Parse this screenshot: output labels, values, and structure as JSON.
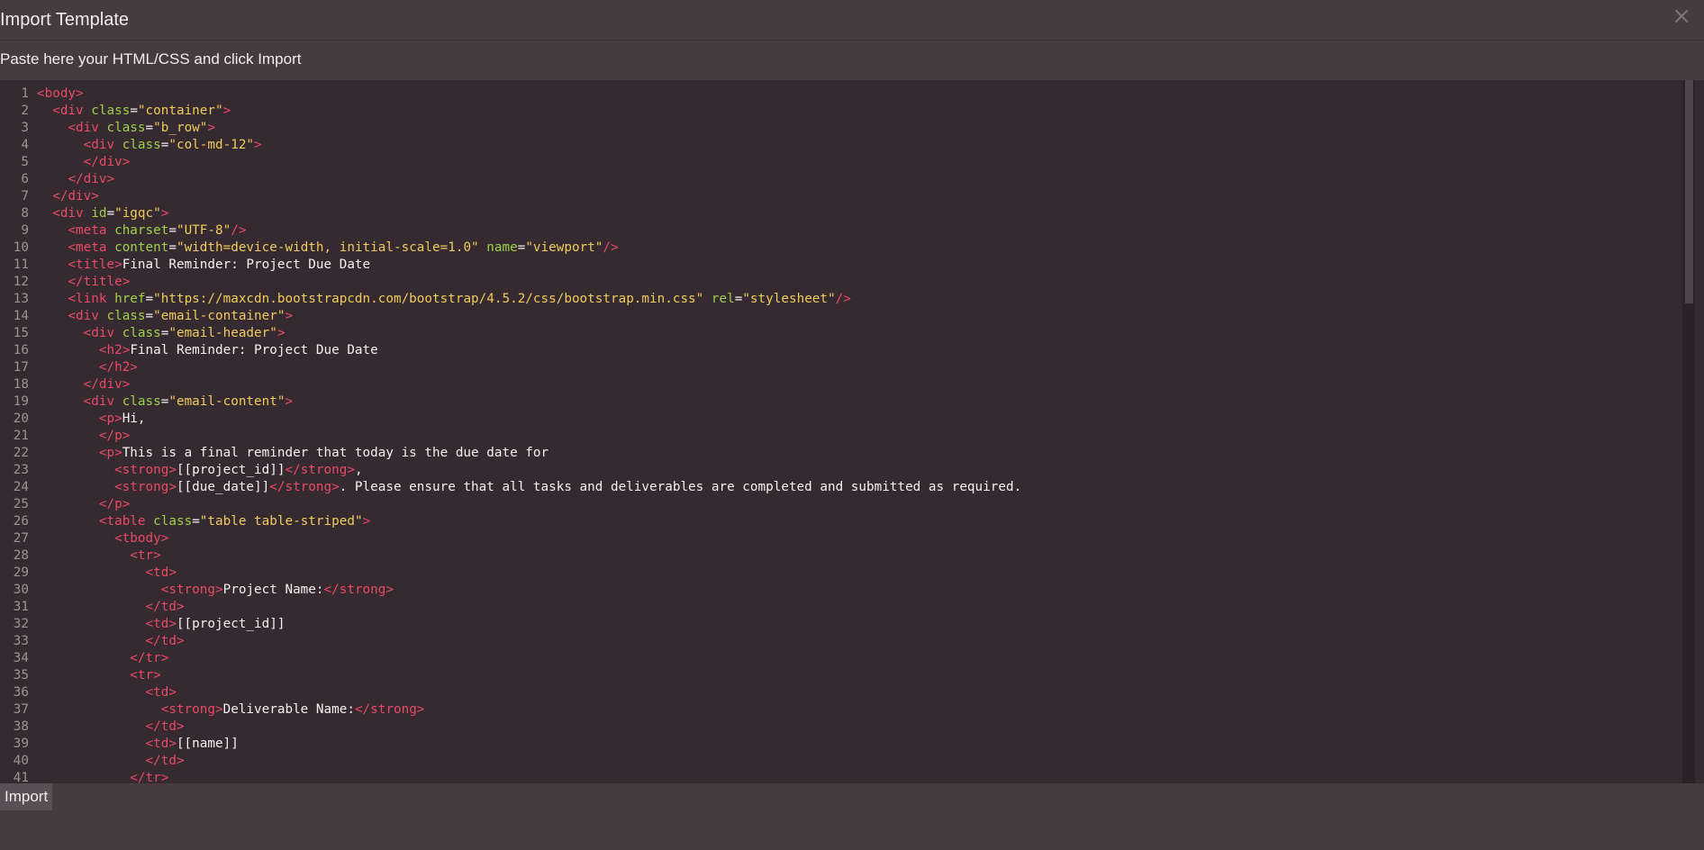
{
  "modal": {
    "title": "Import Template",
    "close_symbol": "×",
    "instructions": "Paste here your HTML/CSS and click Import",
    "import_label": "Import"
  },
  "colors": {
    "tag": "#ea4a66",
    "attribute": "#9fd14a",
    "string": "#f0cb5c",
    "text": "#f4f1f2",
    "editor_bg": "#342a30"
  },
  "code_lines": [
    [
      [
        "t",
        "<body>"
      ]
    ],
    [
      [
        "x",
        "  "
      ],
      [
        "t",
        "<div "
      ],
      [
        "a",
        "class"
      ],
      [
        "x",
        "="
      ],
      [
        "s",
        "\"container\""
      ],
      [
        "t",
        ">"
      ]
    ],
    [
      [
        "x",
        "    "
      ],
      [
        "t",
        "<div "
      ],
      [
        "a",
        "class"
      ],
      [
        "x",
        "="
      ],
      [
        "s",
        "\"b_row\""
      ],
      [
        "t",
        ">"
      ]
    ],
    [
      [
        "x",
        "      "
      ],
      [
        "t",
        "<div "
      ],
      [
        "a",
        "class"
      ],
      [
        "x",
        "="
      ],
      [
        "s",
        "\"col-md-12\""
      ],
      [
        "t",
        ">"
      ]
    ],
    [
      [
        "x",
        "      "
      ],
      [
        "t",
        "</div>"
      ]
    ],
    [
      [
        "x",
        "    "
      ],
      [
        "t",
        "</div>"
      ]
    ],
    [
      [
        "x",
        "  "
      ],
      [
        "t",
        "</div>"
      ]
    ],
    [
      [
        "x",
        "  "
      ],
      [
        "t",
        "<div "
      ],
      [
        "a",
        "id"
      ],
      [
        "x",
        "="
      ],
      [
        "s",
        "\"igqc\""
      ],
      [
        "t",
        ">"
      ]
    ],
    [
      [
        "x",
        "    "
      ],
      [
        "t",
        "<meta "
      ],
      [
        "a",
        "charset"
      ],
      [
        "x",
        "="
      ],
      [
        "s",
        "\"UTF-8\""
      ],
      [
        "t",
        "/>"
      ]
    ],
    [
      [
        "x",
        "    "
      ],
      [
        "t",
        "<meta "
      ],
      [
        "a",
        "content"
      ],
      [
        "x",
        "="
      ],
      [
        "s",
        "\"width=device-width, initial-scale=1.0\""
      ],
      [
        "x",
        " "
      ],
      [
        "a",
        "name"
      ],
      [
        "x",
        "="
      ],
      [
        "s",
        "\"viewport\""
      ],
      [
        "t",
        "/>"
      ]
    ],
    [
      [
        "x",
        "    "
      ],
      [
        "t",
        "<title>"
      ],
      [
        "x",
        "Final Reminder: Project Due Date"
      ]
    ],
    [
      [
        "x",
        "    "
      ],
      [
        "t",
        "</title>"
      ]
    ],
    [
      [
        "x",
        "    "
      ],
      [
        "t",
        "<link "
      ],
      [
        "a",
        "href"
      ],
      [
        "x",
        "="
      ],
      [
        "s",
        "\"https://maxcdn.bootstrapcdn.com/bootstrap/4.5.2/css/bootstrap.min.css\""
      ],
      [
        "x",
        " "
      ],
      [
        "a",
        "rel"
      ],
      [
        "x",
        "="
      ],
      [
        "s",
        "\"stylesheet\""
      ],
      [
        "t",
        "/>"
      ]
    ],
    [
      [
        "x",
        "    "
      ],
      [
        "t",
        "<div "
      ],
      [
        "a",
        "class"
      ],
      [
        "x",
        "="
      ],
      [
        "s",
        "\"email-container\""
      ],
      [
        "t",
        ">"
      ]
    ],
    [
      [
        "x",
        "      "
      ],
      [
        "t",
        "<div "
      ],
      [
        "a",
        "class"
      ],
      [
        "x",
        "="
      ],
      [
        "s",
        "\"email-header\""
      ],
      [
        "t",
        ">"
      ]
    ],
    [
      [
        "x",
        "        "
      ],
      [
        "t",
        "<h2>"
      ],
      [
        "x",
        "Final Reminder: Project Due Date"
      ]
    ],
    [
      [
        "x",
        "        "
      ],
      [
        "t",
        "</h2>"
      ]
    ],
    [
      [
        "x",
        "      "
      ],
      [
        "t",
        "</div>"
      ]
    ],
    [
      [
        "x",
        "      "
      ],
      [
        "t",
        "<div "
      ],
      [
        "a",
        "class"
      ],
      [
        "x",
        "="
      ],
      [
        "s",
        "\"email-content\""
      ],
      [
        "t",
        ">"
      ]
    ],
    [
      [
        "x",
        "        "
      ],
      [
        "t",
        "<p>"
      ],
      [
        "x",
        "Hi,"
      ]
    ],
    [
      [
        "x",
        "        "
      ],
      [
        "t",
        "</p>"
      ]
    ],
    [
      [
        "x",
        "        "
      ],
      [
        "t",
        "<p>"
      ],
      [
        "x",
        "This is a final reminder that today is the due date for"
      ]
    ],
    [
      [
        "x",
        "          "
      ],
      [
        "t",
        "<strong>"
      ],
      [
        "x",
        "[[project_id]]"
      ],
      [
        "t",
        "</strong>"
      ],
      [
        "x",
        ","
      ]
    ],
    [
      [
        "x",
        "          "
      ],
      [
        "t",
        "<strong>"
      ],
      [
        "x",
        "[[due_date]]"
      ],
      [
        "t",
        "</strong>"
      ],
      [
        "x",
        ". Please ensure that all tasks and deliverables are completed and submitted as required."
      ]
    ],
    [
      [
        "x",
        "        "
      ],
      [
        "t",
        "</p>"
      ]
    ],
    [
      [
        "x",
        "        "
      ],
      [
        "t",
        "<table "
      ],
      [
        "a",
        "class"
      ],
      [
        "x",
        "="
      ],
      [
        "s",
        "\"table table-striped\""
      ],
      [
        "t",
        ">"
      ]
    ],
    [
      [
        "x",
        "          "
      ],
      [
        "t",
        "<tbody>"
      ]
    ],
    [
      [
        "x",
        "            "
      ],
      [
        "t",
        "<tr>"
      ]
    ],
    [
      [
        "x",
        "              "
      ],
      [
        "t",
        "<td>"
      ]
    ],
    [
      [
        "x",
        "                "
      ],
      [
        "t",
        "<strong>"
      ],
      [
        "x",
        "Project Name:"
      ],
      [
        "t",
        "</strong>"
      ]
    ],
    [
      [
        "x",
        "              "
      ],
      [
        "t",
        "</td>"
      ]
    ],
    [
      [
        "x",
        "              "
      ],
      [
        "t",
        "<td>"
      ],
      [
        "x",
        "[[project_id]]"
      ]
    ],
    [
      [
        "x",
        "              "
      ],
      [
        "t",
        "</td>"
      ]
    ],
    [
      [
        "x",
        "            "
      ],
      [
        "t",
        "</tr>"
      ]
    ],
    [
      [
        "x",
        "            "
      ],
      [
        "t",
        "<tr>"
      ]
    ],
    [
      [
        "x",
        "              "
      ],
      [
        "t",
        "<td>"
      ]
    ],
    [
      [
        "x",
        "                "
      ],
      [
        "t",
        "<strong>"
      ],
      [
        "x",
        "Deliverable Name:"
      ],
      [
        "t",
        "</strong>"
      ]
    ],
    [
      [
        "x",
        "              "
      ],
      [
        "t",
        "</td>"
      ]
    ],
    [
      [
        "x",
        "              "
      ],
      [
        "t",
        "<td>"
      ],
      [
        "x",
        "[[name]]"
      ]
    ],
    [
      [
        "x",
        "              "
      ],
      [
        "t",
        "</td>"
      ]
    ],
    [
      [
        "x",
        "            "
      ],
      [
        "t",
        "</tr>"
      ]
    ]
  ]
}
